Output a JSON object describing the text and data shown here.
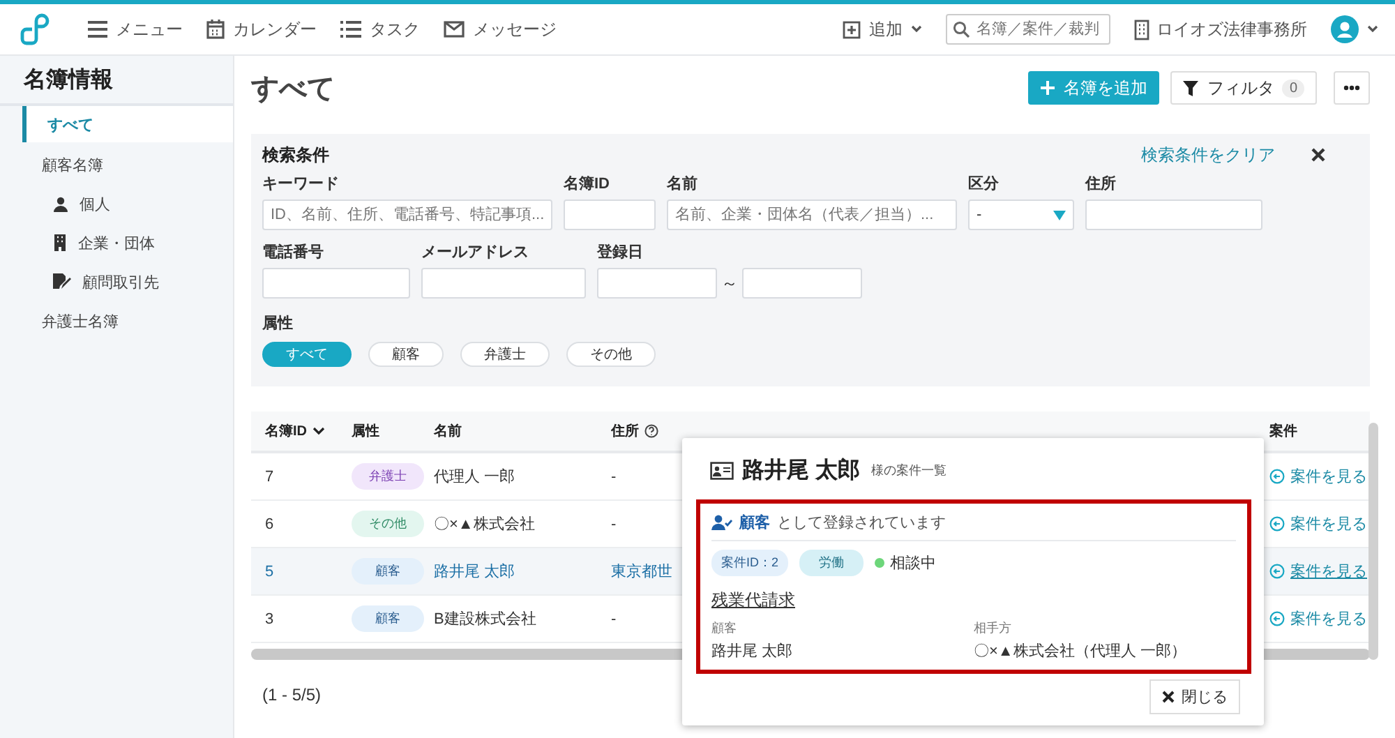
{
  "header": {
    "nav": [
      {
        "label": "メニュー",
        "kind": "menu"
      },
      {
        "label": "カレンダー",
        "kind": "calendar"
      },
      {
        "label": "タスク",
        "kind": "list"
      },
      {
        "label": "メッセージ",
        "kind": "mail"
      }
    ],
    "add": "追加",
    "search_placeholder": "名簿／案件／裁判",
    "office": "ロイオズ法律事務所"
  },
  "sidebar": {
    "title": "名簿情報",
    "items": [
      {
        "label": "すべて",
        "selected": true
      },
      {
        "label": "顧客名簿",
        "selected": false,
        "children": [
          {
            "label": "個人",
            "kind": "person",
            "selected": false
          },
          {
            "label": "企業・団体",
            "kind": "company",
            "selected": false
          },
          {
            "label": "顧問取引先",
            "kind": "advisor",
            "selected": false
          }
        ]
      },
      {
        "label": "弁護士名簿",
        "selected": false
      }
    ]
  },
  "page": {
    "title": "すべて",
    "add_button": "名簿を追加",
    "filter_button": "フィルタ",
    "filter_count": "0"
  },
  "filter": {
    "title": "検索条件",
    "clear": "検索条件をクリア",
    "fields": [
      {
        "label": "キーワード",
        "kind": "text",
        "placeholder": "ID、名前、住所、電話番号、特記事項..."
      },
      {
        "label": "名簿ID",
        "kind": "text"
      },
      {
        "label": "名前",
        "kind": "text",
        "placeholder": "名前、企業・団体名（代表／担当）..."
      },
      {
        "label": "区分",
        "kind": "select",
        "value": "-"
      },
      {
        "label": "住所",
        "kind": "text"
      },
      {
        "label": "電話番号",
        "kind": "text"
      },
      {
        "label": "メールアドレス",
        "kind": "text"
      },
      {
        "label": "登録日",
        "kind": "range",
        "separator": "～"
      }
    ],
    "attr_label": "属性",
    "attrs": [
      {
        "label": "すべて",
        "selected": true
      },
      {
        "label": "顧客",
        "selected": false
      },
      {
        "label": "弁護士",
        "selected": false
      },
      {
        "label": "その他",
        "selected": false
      }
    ]
  },
  "table": {
    "columns": [
      {
        "label": "名簿ID",
        "sort": true,
        "help": false
      },
      {
        "label": "属性",
        "sort": false,
        "help": false
      },
      {
        "label": "名前",
        "sort": false,
        "help": false
      },
      {
        "label": "住所",
        "sort": false,
        "help": true
      },
      {
        "label": "案件",
        "sort": false,
        "help": false
      }
    ],
    "rows": [
      {
        "id": "7",
        "tag": "弁護士",
        "kind": "lawyer",
        "name": "代理人 一郎",
        "address": "-",
        "link": "案件を見る",
        "selected": false
      },
      {
        "id": "6",
        "tag": "その他",
        "kind": "other",
        "name": "〇×▲株式会社",
        "address": "-",
        "link": "案件を見る",
        "selected": false
      },
      {
        "id": "5",
        "tag": "顧客",
        "kind": "client",
        "name": "路井尾 太郎",
        "address": "東京都世",
        "link": "案件を見る",
        "selected": true
      },
      {
        "id": "3",
        "tag": "顧客",
        "kind": "client",
        "name": "B建設株式会社",
        "address": "-",
        "link": "案件を見る",
        "selected": false
      }
    ],
    "pagination": "(1 - 5/5)"
  },
  "modal": {
    "name": "路井尾 太郎",
    "subtitle": "様の案件一覧",
    "role": "顧客",
    "role_text": "として登録されています",
    "case": {
      "id": "案件ID：2",
      "category": "労働",
      "status": "相談中",
      "color": "#6dd67a",
      "title": "残業代請求",
      "parties": [
        {
          "label": "顧客",
          "value": "路井尾 太郎"
        },
        {
          "label": "相手方",
          "value": "〇×▲株式会社（代理人 一郎）"
        }
      ]
    },
    "close": "閉じる"
  }
}
